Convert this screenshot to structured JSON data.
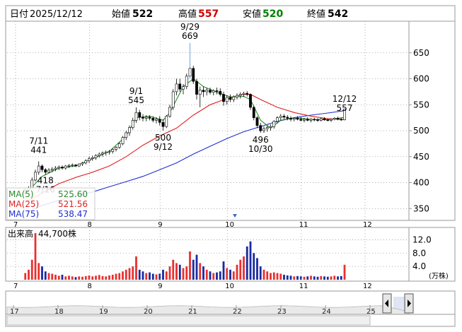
{
  "header": {
    "date_label": "日付",
    "date": "2025/12/12",
    "open_label": "始値",
    "open": "522",
    "high_label": "高値",
    "high": "557",
    "low_label": "安値",
    "low": "520",
    "close_label": "終値",
    "close": "542"
  },
  "colors": {
    "up": "#ffffff",
    "down": "#000000",
    "ma5": "#2a8a2a",
    "ma25": "#e02020",
    "ma75": "#1f2fd0",
    "volume_up": "#e83030",
    "volume_down": "#1a2aa0",
    "grid": "#9a9a9a",
    "high_value": "#d00000",
    "low_value": "#008000",
    "spike_line": "#4a90d0",
    "navigator_fill": "#dde6f2",
    "navigator_handle": "#e6e6e6"
  },
  "legend": {
    "ma5_label": "MA(5)",
    "ma5_value": "525.60",
    "ma25_label": "MA(25)",
    "ma25_value": "521.56",
    "ma75_label": "MA(75)",
    "ma75_value": "538.47"
  },
  "volume_panel": {
    "label": "出来高",
    "value": "44,700株",
    "unit": "(万株)"
  },
  "chart_data": {
    "type": "candlestick",
    "price_axis": {
      "ticks": [
        350,
        400,
        450,
        500,
        550,
        600,
        650
      ],
      "min": 330,
      "max": 700
    },
    "volume_axis": {
      "ticks": [
        4.0,
        8.0,
        12.0
      ],
      "labels": [
        "4.0",
        "8.0",
        "12.0"
      ],
      "min": 0,
      "max": 14
    },
    "month_ticks": [
      "7",
      "8",
      "9",
      "10",
      "11",
      "12"
    ],
    "navigator_ticks": [
      "17",
      "18",
      "19",
      "20",
      "21",
      "22",
      "23",
      "24",
      "25"
    ],
    "session_count": 118,
    "month_start_index": [
      0,
      22,
      43,
      63,
      85,
      104
    ],
    "candles": [
      [
        5,
        380,
        390,
        376,
        386
      ],
      [
        6,
        386,
        393,
        383,
        390
      ],
      [
        7,
        390,
        410,
        388,
        405
      ],
      [
        8,
        405,
        425,
        402,
        420
      ],
      [
        9,
        420,
        441,
        415,
        432
      ],
      [
        10,
        432,
        435,
        420,
        425
      ],
      [
        11,
        425,
        428,
        415,
        420
      ],
      [
        12,
        420,
        428,
        418,
        424
      ],
      [
        13,
        424,
        430,
        420,
        426
      ],
      [
        14,
        426,
        432,
        422,
        428
      ],
      [
        15,
        428,
        433,
        424,
        430
      ],
      [
        16,
        430,
        433,
        425,
        428
      ],
      [
        17,
        428,
        434,
        425,
        432
      ],
      [
        18,
        432,
        436,
        428,
        433
      ],
      [
        19,
        433,
        437,
        430,
        434
      ],
      [
        20,
        434,
        436,
        430,
        432
      ],
      [
        21,
        432,
        437,
        430,
        436
      ],
      [
        22,
        436,
        440,
        432,
        438
      ],
      [
        23,
        438,
        445,
        435,
        442
      ],
      [
        24,
        442,
        450,
        438,
        446
      ],
      [
        25,
        446,
        452,
        442,
        448
      ],
      [
        26,
        448,
        455,
        444,
        452
      ],
      [
        27,
        452,
        458,
        448,
        455
      ],
      [
        28,
        455,
        460,
        450,
        457
      ],
      [
        29,
        457,
        462,
        452,
        459
      ],
      [
        30,
        459,
        463,
        454,
        460
      ],
      [
        31,
        460,
        466,
        456,
        464
      ],
      [
        32,
        464,
        470,
        460,
        468
      ],
      [
        33,
        468,
        478,
        465,
        475
      ],
      [
        34,
        475,
        490,
        472,
        487
      ],
      [
        35,
        487,
        500,
        482,
        496
      ],
      [
        36,
        496,
        510,
        490,
        506
      ],
      [
        37,
        506,
        525,
        502,
        520
      ],
      [
        38,
        520,
        545,
        515,
        535
      ],
      [
        39,
        535,
        540,
        520,
        526
      ],
      [
        40,
        526,
        532,
        518,
        524
      ],
      [
        41,
        524,
        530,
        518,
        526
      ],
      [
        42,
        526,
        530,
        520,
        524
      ],
      [
        43,
        524,
        528,
        516,
        520
      ],
      [
        44,
        520,
        526,
        514,
        522
      ],
      [
        45,
        522,
        528,
        510,
        516
      ],
      [
        46,
        516,
        522,
        500,
        508
      ],
      [
        47,
        508,
        530,
        505,
        528
      ],
      [
        48,
        528,
        550,
        525,
        545
      ],
      [
        49,
        545,
        580,
        540,
        575
      ],
      [
        50,
        575,
        600,
        568,
        590
      ],
      [
        51,
        590,
        600,
        575,
        580
      ],
      [
        52,
        580,
        590,
        570,
        585
      ],
      [
        53,
        585,
        610,
        580,
        605
      ],
      [
        54,
        605,
        669,
        600,
        620
      ],
      [
        55,
        620,
        625,
        590,
        595
      ],
      [
        56,
        595,
        600,
        560,
        570
      ],
      [
        57,
        570,
        585,
        545,
        578
      ],
      [
        58,
        578,
        585,
        565,
        575
      ],
      [
        59,
        575,
        582,
        568,
        578
      ],
      [
        60,
        578,
        583,
        570,
        574
      ],
      [
        61,
        574,
        580,
        568,
        577
      ],
      [
        62,
        577,
        583,
        570,
        576
      ],
      [
        63,
        576,
        582,
        566,
        570
      ],
      [
        64,
        570,
        575,
        548,
        556
      ],
      [
        65,
        556,
        568,
        550,
        564
      ],
      [
        66,
        564,
        570,
        555,
        560
      ],
      [
        67,
        560,
        568,
        555,
        565
      ],
      [
        68,
        565,
        572,
        560,
        568
      ],
      [
        69,
        568,
        574,
        562,
        570
      ],
      [
        70,
        570,
        575,
        565,
        572
      ],
      [
        71,
        572,
        576,
        566,
        570
      ],
      [
        72,
        570,
        572,
        540,
        545
      ],
      [
        73,
        545,
        548,
        520,
        525
      ],
      [
        74,
        525,
        528,
        505,
        510
      ],
      [
        75,
        510,
        515,
        496,
        500
      ],
      [
        76,
        500,
        508,
        496,
        504
      ],
      [
        77,
        504,
        510,
        498,
        506
      ],
      [
        78,
        506,
        512,
        500,
        508
      ],
      [
        79,
        508,
        520,
        504,
        518
      ],
      [
        80,
        518,
        528,
        514,
        525
      ],
      [
        81,
        525,
        532,
        520,
        528
      ],
      [
        82,
        528,
        532,
        522,
        526
      ],
      [
        83,
        526,
        530,
        520,
        524
      ],
      [
        84,
        524,
        528,
        518,
        522
      ],
      [
        85,
        522,
        526,
        518,
        524
      ],
      [
        86,
        524,
        528,
        520,
        522
      ],
      [
        87,
        522,
        526,
        518,
        520
      ],
      [
        88,
        520,
        524,
        516,
        522
      ],
      [
        89,
        522,
        526,
        518,
        520
      ],
      [
        90,
        520,
        524,
        516,
        522
      ],
      [
        91,
        522,
        525,
        518,
        521
      ],
      [
        92,
        521,
        524,
        517,
        520
      ],
      [
        93,
        520,
        525,
        518,
        523
      ],
      [
        94,
        523,
        526,
        519,
        521
      ],
      [
        95,
        521,
        524,
        518,
        520
      ],
      [
        96,
        520,
        523,
        517,
        522
      ],
      [
        97,
        522,
        526,
        520,
        524
      ],
      [
        98,
        524,
        527,
        520,
        522
      ],
      [
        99,
        522,
        525,
        519,
        521
      ],
      [
        100,
        521,
        530,
        520,
        542
      ]
    ],
    "ma5": [
      [
        5,
        378
      ],
      [
        10,
        412
      ],
      [
        15,
        428
      ],
      [
        20,
        432
      ],
      [
        25,
        446
      ],
      [
        30,
        460
      ],
      [
        35,
        490
      ],
      [
        38,
        525
      ],
      [
        42,
        528
      ],
      [
        46,
        520
      ],
      [
        48,
        535
      ],
      [
        50,
        560
      ],
      [
        52,
        585
      ],
      [
        55,
        600
      ],
      [
        58,
        585
      ],
      [
        62,
        574
      ],
      [
        66,
        565
      ],
      [
        70,
        566
      ],
      [
        72,
        560
      ],
      [
        75,
        520
      ],
      [
        78,
        505
      ],
      [
        81,
        520
      ],
      [
        85,
        525
      ],
      [
        90,
        522
      ],
      [
        95,
        521
      ],
      [
        100,
        525.6
      ]
    ],
    "ma25": [
      [
        5,
        362
      ],
      [
        10,
        380
      ],
      [
        15,
        398
      ],
      [
        20,
        410
      ],
      [
        25,
        420
      ],
      [
        30,
        432
      ],
      [
        35,
        450
      ],
      [
        40,
        472
      ],
      [
        45,
        490
      ],
      [
        50,
        505
      ],
      [
        55,
        530
      ],
      [
        60,
        550
      ],
      [
        65,
        562
      ],
      [
        70,
        570
      ],
      [
        72,
        570
      ],
      [
        75,
        560
      ],
      [
        80,
        545
      ],
      [
        85,
        535
      ],
      [
        90,
        528
      ],
      [
        95,
        523
      ],
      [
        100,
        521.56
      ]
    ],
    "ma75": [
      [
        5,
        342
      ],
      [
        10,
        356
      ],
      [
        15,
        366
      ],
      [
        20,
        374
      ],
      [
        25,
        382
      ],
      [
        30,
        392
      ],
      [
        35,
        402
      ],
      [
        40,
        412
      ],
      [
        45,
        425
      ],
      [
        50,
        438
      ],
      [
        55,
        455
      ],
      [
        60,
        470
      ],
      [
        65,
        485
      ],
      [
        70,
        498
      ],
      [
        75,
        508
      ],
      [
        80,
        518
      ],
      [
        85,
        525
      ],
      [
        90,
        530
      ],
      [
        95,
        534
      ],
      [
        100,
        538.47
      ]
    ],
    "volumes": [
      [
        5,
        2.0
      ],
      [
        6,
        3.0
      ],
      [
        7,
        6.0
      ],
      [
        8,
        14.0
      ],
      [
        9,
        5.0
      ],
      [
        10,
        4.0
      ],
      [
        11,
        2.5
      ],
      [
        12,
        2.0
      ],
      [
        13,
        1.8
      ],
      [
        14,
        1.5
      ],
      [
        15,
        1.2
      ],
      [
        16,
        1.5
      ],
      [
        17,
        1.0
      ],
      [
        18,
        1.2
      ],
      [
        19,
        1.0
      ],
      [
        20,
        0.8
      ],
      [
        21,
        1.0
      ],
      [
        22,
        0.9
      ],
      [
        23,
        1.1
      ],
      [
        24,
        1.3
      ],
      [
        25,
        1.0
      ],
      [
        26,
        1.2
      ],
      [
        27,
        1.4
      ],
      [
        28,
        1.1
      ],
      [
        29,
        1.0
      ],
      [
        30,
        1.3
      ],
      [
        31,
        1.5
      ],
      [
        32,
        1.8
      ],
      [
        33,
        2.0
      ],
      [
        34,
        2.5
      ],
      [
        35,
        3.0
      ],
      [
        36,
        3.5
      ],
      [
        37,
        4.0
      ],
      [
        38,
        7.0
      ],
      [
        39,
        3.0
      ],
      [
        40,
        2.5
      ],
      [
        41,
        2.0
      ],
      [
        42,
        2.2
      ],
      [
        43,
        1.8
      ],
      [
        44,
        1.6
      ],
      [
        45,
        1.8
      ],
      [
        46,
        3.0
      ],
      [
        47,
        2.5
      ],
      [
        48,
        4.0
      ],
      [
        49,
        6.0
      ],
      [
        50,
        5.0
      ],
      [
        51,
        4.5
      ],
      [
        52,
        3.5
      ],
      [
        53,
        4.0
      ],
      [
        54,
        8.5
      ],
      [
        55,
        6.0
      ],
      [
        56,
        7.5
      ],
      [
        57,
        5.0
      ],
      [
        58,
        4.0
      ],
      [
        59,
        3.0
      ],
      [
        60,
        2.5
      ],
      [
        61,
        2.0
      ],
      [
        62,
        2.2
      ],
      [
        63,
        2.5
      ],
      [
        64,
        5.5
      ],
      [
        65,
        3.5
      ],
      [
        66,
        3.0
      ],
      [
        67,
        2.5
      ],
      [
        68,
        4.5
      ],
      [
        69,
        6.0
      ],
      [
        70,
        7.0
      ],
      [
        71,
        10.0
      ],
      [
        72,
        11.5
      ],
      [
        73,
        8.0
      ],
      [
        74,
        6.5
      ],
      [
        75,
        4.0
      ],
      [
        76,
        3.0
      ],
      [
        77,
        2.5
      ],
      [
        78,
        2.0
      ],
      [
        79,
        2.2
      ],
      [
        80,
        2.0
      ],
      [
        81,
        1.8
      ],
      [
        82,
        1.5
      ],
      [
        83,
        1.3
      ],
      [
        84,
        1.2
      ],
      [
        85,
        1.0
      ],
      [
        86,
        1.1
      ],
      [
        87,
        1.0
      ],
      [
        88,
        0.9
      ],
      [
        89,
        1.0
      ],
      [
        90,
        1.2
      ],
      [
        91,
        1.0
      ],
      [
        92,
        0.9
      ],
      [
        93,
        1.1
      ],
      [
        94,
        1.0
      ],
      [
        95,
        0.9
      ],
      [
        96,
        1.0
      ],
      [
        97,
        1.2
      ],
      [
        98,
        1.0
      ],
      [
        99,
        1.1
      ],
      [
        100,
        4.5
      ]
    ],
    "annotations": [
      {
        "index": 9,
        "date": "7/11",
        "value": "441",
        "at": "high"
      },
      {
        "index": 11,
        "date": "7/16",
        "value": "418",
        "at": "low"
      },
      {
        "index": 38,
        "date": "9/1",
        "value": "545",
        "at": "high"
      },
      {
        "index": 46,
        "date": "9/12",
        "value": "500",
        "at": "low"
      },
      {
        "index": 54,
        "date": "9/29",
        "value": "669",
        "at": "high"
      },
      {
        "index": 75,
        "date": "10/30",
        "value": "496",
        "at": "low"
      },
      {
        "index": 100,
        "date": "12/12",
        "value": "557",
        "at": "high"
      }
    ]
  }
}
